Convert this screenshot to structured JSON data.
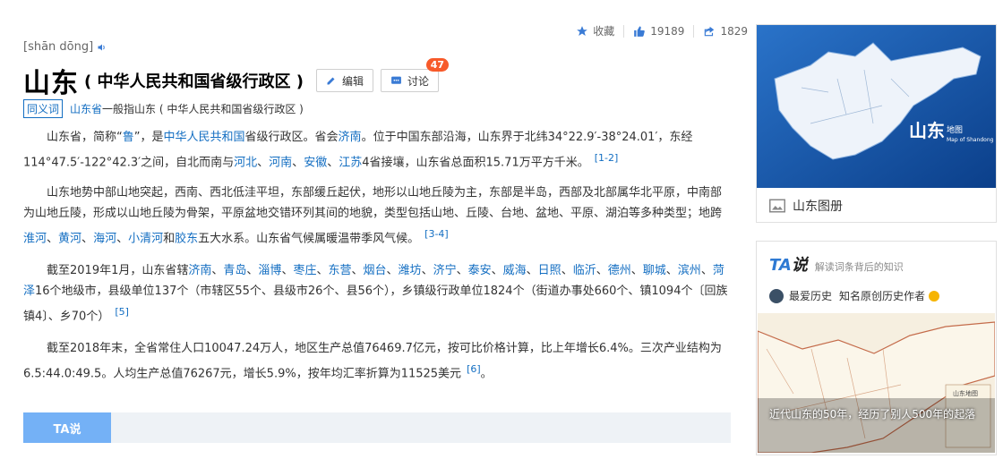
{
  "toolbar": {
    "collect_label": "收藏",
    "like_count": "19189",
    "share_count": "1829"
  },
  "entry": {
    "pinyin": "[shān dōng]",
    "title": "山东",
    "subtitle": "( 中华人民共和国省级行政区 )",
    "edit_label": "编辑",
    "discuss_label": "讨论",
    "discuss_badge": "47",
    "synonym_tag": "同义词",
    "synonym_link": "山东省",
    "synonym_text": "一般指山东 ( 中华人民共和国省级行政区 )"
  },
  "paragraphs": {
    "p1": {
      "t1": "山东省，简称“",
      "l1": "鲁",
      "t2": "”，是",
      "l2": "中华人民共和国",
      "t3": "省级行政区。省会",
      "l3": "济南",
      "t4": "。位于中国东部沿海，山东界于北纬34°22.9′-38°24.01′，东经114°47.5′-122°42.3′之间，自北而南与",
      "l4": "河北",
      "t5": "、",
      "l5": "河南",
      "t6": "、",
      "l6": "安徽",
      "t7": "、",
      "l7": "江苏",
      "t8": "4省接壤，山东省总面积15.71万平方千米。",
      "ref": "[1-2]"
    },
    "p2": {
      "t1": "山东地势中部山地突起，西南、西北低洼平坦，东部缓丘起伏，地形以山地丘陵为主，东部是半岛，西部及北部属华北平原，中南部为山地丘陵，形成以山地丘陵为骨架，平原盆地交错环列其间的地貌，类型包括山地、丘陵、台地、盆地、平原、湖泊等多种类型；地跨",
      "l1": "淮河",
      "t2": "、",
      "l2": "黄河",
      "t3": "、",
      "l3": "海河",
      "t4": "、",
      "l4": "小清河",
      "t5": "和",
      "l5": "胶东",
      "t6": "五大水系。山东省气候属暖温带季风气候。",
      "ref": "[3-4]"
    },
    "p3": {
      "t1": "截至2019年1月，山东省辖",
      "cities": [
        "济南",
        "青岛",
        "淄博",
        "枣庄",
        "东营",
        "烟台",
        "潍坊",
        "济宁",
        "泰安",
        "威海",
        "日照",
        "临沂",
        "德州",
        "聊城",
        "滨州",
        "菏泽"
      ],
      "t2": "16个地级市，县级单位137个（市辖区55个、县级市26个、县56个），乡镇级行政单位1824个（街道办事处660个、镇1094个〔回族镇4〕、乡70个）",
      "ref": "[5]"
    },
    "p4": {
      "t1": "截至2018年末，全省常住人口10047.24万人，地区生产总值76469.7亿元，按可比价格计算，比上年增长6.4%。三次产业结构为6.5:44.0:49.5。人均生产总值76267元，增长5.9%，按年均汇率折算为11525美元",
      "ref": "[6]",
      "t2": "。"
    }
  },
  "ta_bar": {
    "tab_label": "TA说"
  },
  "album": {
    "map_title": "山东",
    "map_sub1": "地图",
    "map_sub2": "Map of Shandong",
    "label": "山东图册"
  },
  "ta_card": {
    "logo_a": "TA",
    "logo_b": "说",
    "desc": "解读词条背后的知识",
    "author": "最爱历史",
    "author_desc": "知名原创历史作者",
    "map_label": "山东地图",
    "caption": "近代山东的50年，经历了别人500年的起落"
  },
  "colors": {
    "link": "#136ec2",
    "badge": "#f75a2a",
    "ta_tab": "#74b1f6",
    "ta_logo": "#2f7ad3"
  }
}
